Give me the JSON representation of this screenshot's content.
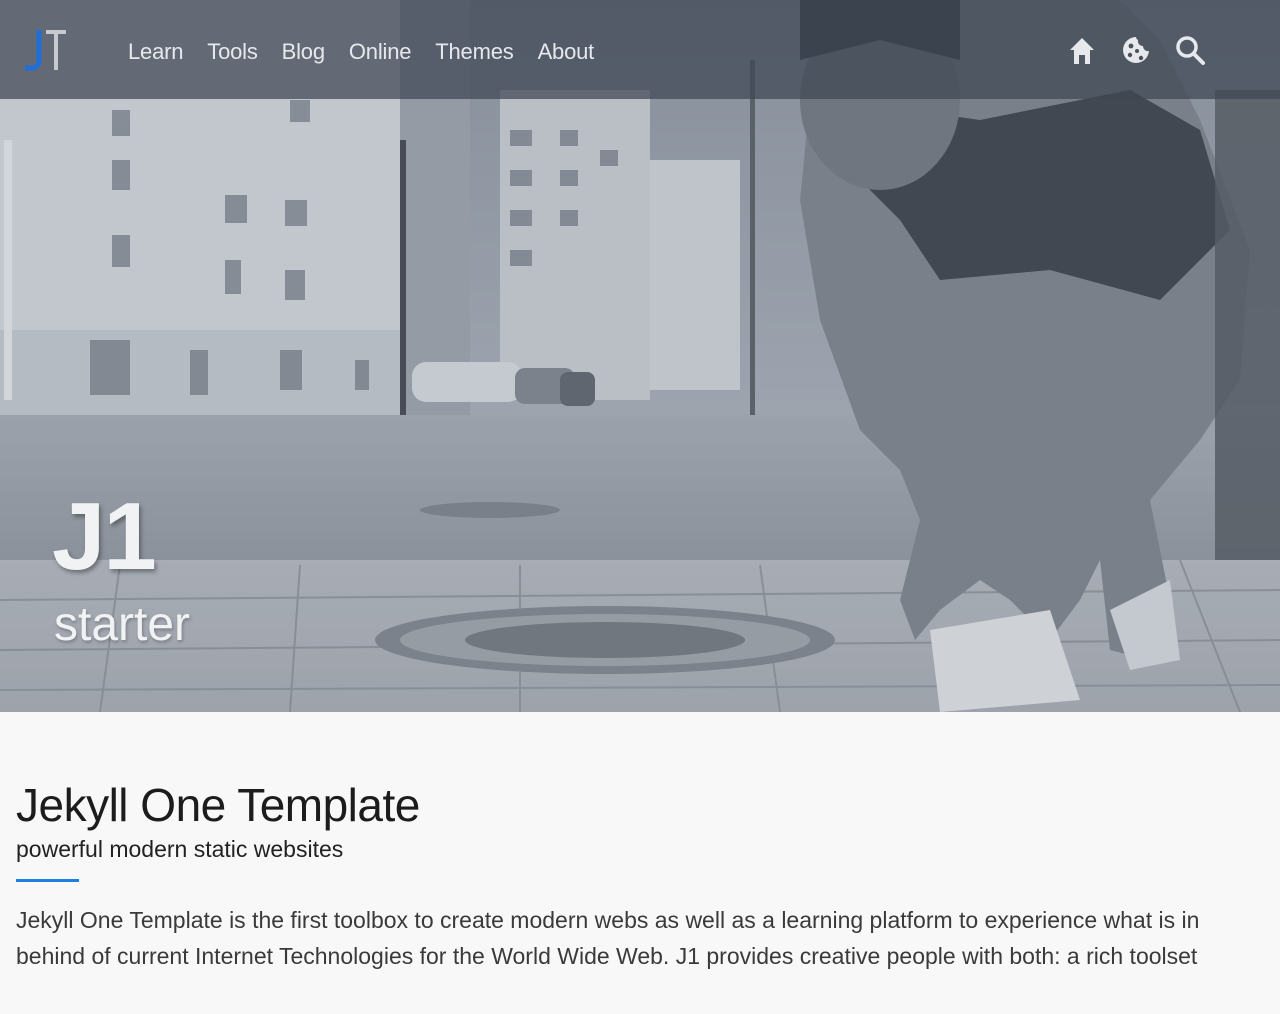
{
  "navbar": {
    "brand_logo": "j1-logo",
    "links": [
      {
        "label": "Learn"
      },
      {
        "label": "Tools"
      },
      {
        "label": "Blog"
      },
      {
        "label": "Online"
      },
      {
        "label": "Themes"
      },
      {
        "label": "About"
      }
    ],
    "icons": [
      "home-icon",
      "cookie-icon",
      "search-icon"
    ]
  },
  "hero": {
    "title": "J1",
    "tagline": "starter"
  },
  "content": {
    "title": "Jekyll One Template",
    "subtitle": "powerful modern static websites",
    "intro": "Jekyll One Template is the first toolbox to create modern webs as well as a learning platform to experience what is in behind of current Internet Technologies for the World Wide Web. J1 provides creative people with both: a rich toolset"
  },
  "colors": {
    "accent": "#1f7fe0",
    "navbar_bg": "#3e4654",
    "nav_text": "#e6e8ec",
    "body_bg": "#f8f8f8"
  }
}
